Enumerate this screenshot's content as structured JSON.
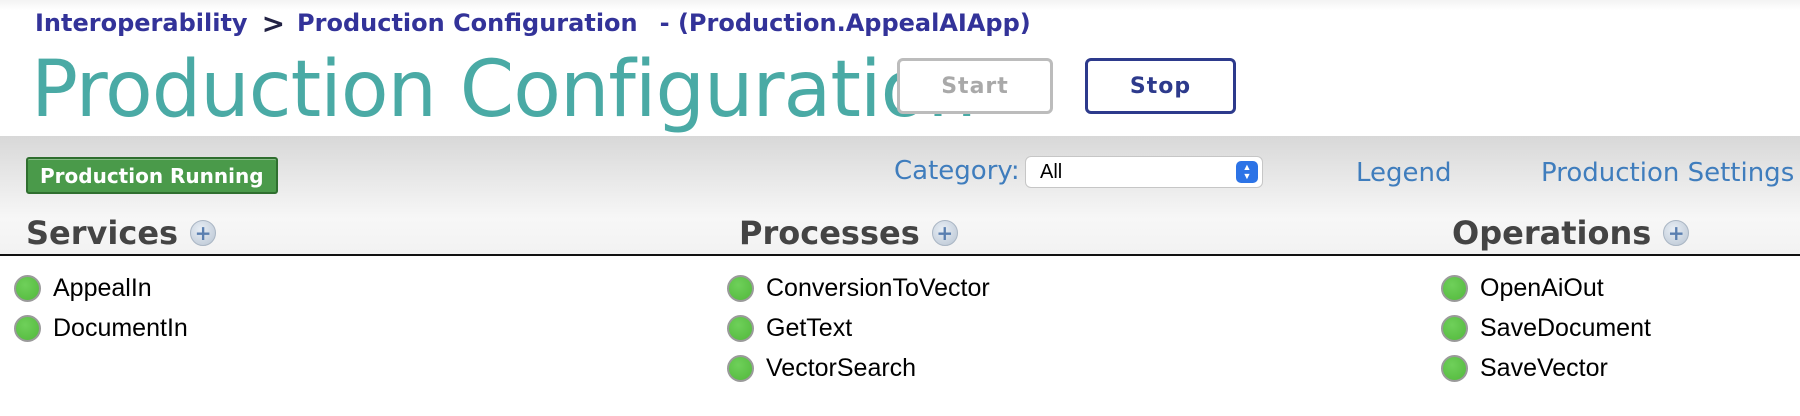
{
  "breadcrumb": {
    "root": "Interoperability",
    "separator": ">",
    "current": "Production Configuration",
    "production": "- (Production.AppealAIApp)"
  },
  "page": {
    "title": "Production Configuration"
  },
  "controls": {
    "start_label": "Start",
    "stop_label": "Stop"
  },
  "toolbar": {
    "status": "Production Running",
    "category_label": "Category:",
    "category_value": "All",
    "legend_label": "Legend",
    "settings_label": "Production Settings"
  },
  "columns": {
    "services": {
      "heading": "Services",
      "add_icon": "plus-icon",
      "items": [
        "AppealIn",
        "DocumentIn"
      ]
    },
    "processes": {
      "heading": "Processes",
      "add_icon": "plus-icon",
      "items": [
        "ConversionToVector",
        "GetText",
        "VectorSearch"
      ]
    },
    "operations": {
      "heading": "Operations",
      "add_icon": "plus-icon",
      "items": [
        "OpenAiOut",
        "SaveDocument",
        "SaveVector"
      ]
    }
  },
  "colors": {
    "title": "#4aaaa5",
    "breadcrumb": "#333399",
    "status_badge": "#4a9a4a",
    "item_status_ok": "#5cc248",
    "link": "#3f7dbd"
  }
}
